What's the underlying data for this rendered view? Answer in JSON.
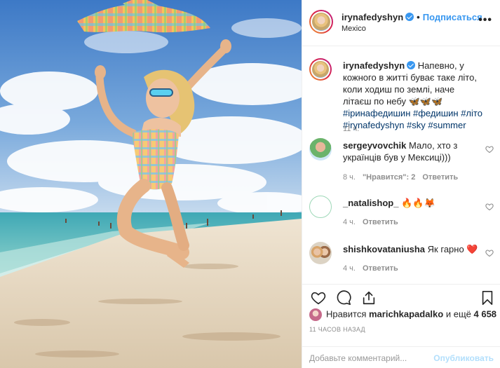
{
  "post": {
    "username": "irynafedyshyn",
    "follow_label": "Подписаться",
    "location": "Mexico",
    "more_label": "•••"
  },
  "caption": {
    "username": "irynafedyshyn",
    "text": "Напевно, у кожного в житті буває таке літо, коли ходиш по землі, наче літаєш по небу",
    "emoji": "🦋🦋🦋",
    "hashtags": "#іринафедишин #федишин #літо #irynafedyshyn #sky #summer",
    "time": "11 ч."
  },
  "comments": [
    {
      "username": "sergeyvovchik",
      "text": "Мало, хто з українців був у Мексиці)))",
      "time": "8 ч.",
      "likes_label": "\"Нравится\": 2",
      "reply_label": "Ответить"
    },
    {
      "username": "_natalishop_",
      "text": "🔥🔥🦊",
      "time": "4 ч.",
      "reply_label": "Ответить"
    },
    {
      "username": "shishkovataniusha",
      "text": "Як гарно ❤️",
      "time": "4 ч.",
      "reply_label": "Ответить"
    }
  ],
  "likes": {
    "prefix": "Нравится",
    "user": "marichkapadalko",
    "middle": "и ещё",
    "count": "4 658"
  },
  "time_ago": "11 ЧАСОВ НАЗАД",
  "add_comment": {
    "placeholder": "Добавьте комментарий...",
    "publish_label": "Опубликовать"
  },
  "icons": [
    "heart-icon",
    "comment-icon",
    "share-icon",
    "bookmark-icon",
    "verified-icon",
    "more-icon"
  ],
  "colors": {
    "link": "#3897f0",
    "hashtag": "#003569",
    "muted": "#8e8e8e",
    "liked_heart": "#ed4956"
  }
}
